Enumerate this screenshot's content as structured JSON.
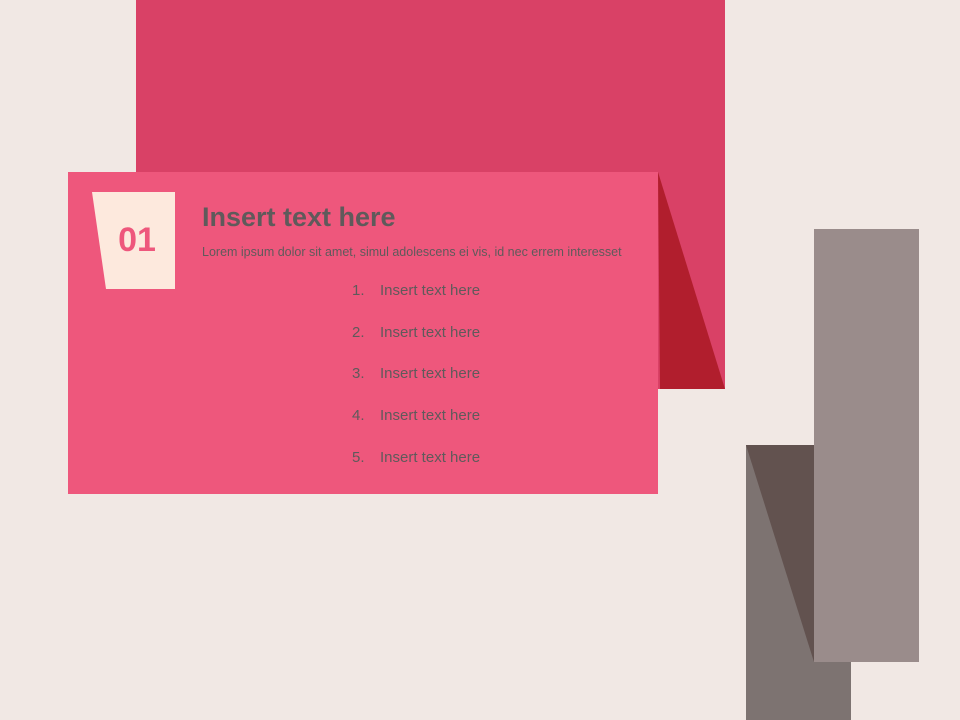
{
  "slide": {
    "number": "01",
    "title": "Insert text here",
    "body": "Lorem ipsum dolor sit amet, simul adolescens ei vis, id nec errem interesset",
    "list": [
      {
        "num": "1.",
        "text": "Insert text here"
      },
      {
        "num": "2.",
        "text": "Insert text here"
      },
      {
        "num": "3.",
        "text": "Insert text here"
      },
      {
        "num": "4.",
        "text": "Insert text here"
      },
      {
        "num": "5.",
        "text": "Insert text here"
      }
    ]
  },
  "colors": {
    "background": "#f1e8e4",
    "pink_card": "#ee577c",
    "pink_back": "#d94166",
    "red_fold": "#b11e2d",
    "tag_fill": "#fde9dd",
    "gray_light": "#9a8c8b",
    "gray_dark": "#7d7371",
    "gray_fold": "#62524f",
    "text": "#5f5a5b"
  }
}
